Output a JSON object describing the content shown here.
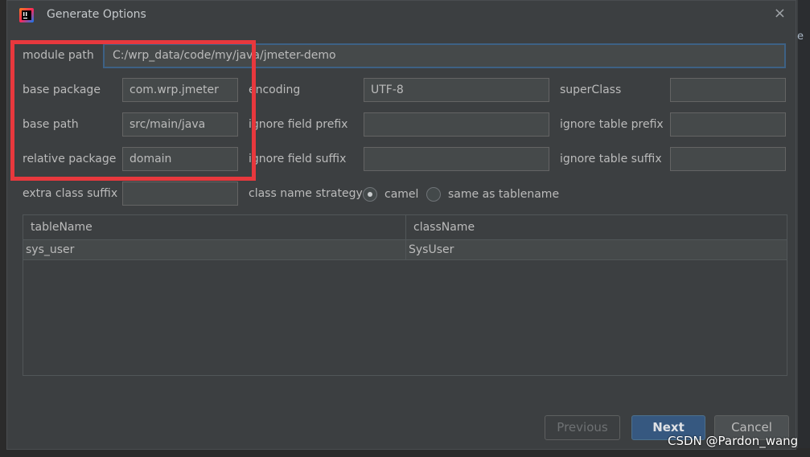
{
  "dialog": {
    "title": "Generate Options",
    "close_glyph": "×",
    "app_icon": "intellij-idea-icon"
  },
  "background": {
    "letter": "e"
  },
  "form": {
    "module_path": {
      "label": "module path",
      "value": "C:/wrp_data/code/my/java/jmeter-demo"
    },
    "base_package": {
      "label": "base package",
      "value": "com.wrp.jmeter"
    },
    "base_path": {
      "label": "base path",
      "value": "src/main/java"
    },
    "relative_package": {
      "label": "relative package",
      "value": "domain"
    },
    "extra_class_suffix": {
      "label": "extra class suffix",
      "value": ""
    },
    "encoding": {
      "label": "encoding",
      "value": "UTF-8"
    },
    "ignore_field_prefix": {
      "label": "ignore field prefix",
      "value": ""
    },
    "ignore_field_suffix": {
      "label": "ignore field suffix",
      "value": ""
    },
    "super_class": {
      "label": "superClass",
      "value": ""
    },
    "ignore_table_prefix": {
      "label": "ignore table prefix",
      "value": ""
    },
    "ignore_table_suffix": {
      "label": "ignore table suffix",
      "value": ""
    },
    "class_name_strategy": {
      "label": "class name strategy",
      "options": [
        {
          "label": "camel",
          "selected": true
        },
        {
          "label": "same as tablename",
          "selected": false
        }
      ]
    }
  },
  "table": {
    "columns": [
      "tableName",
      "className"
    ],
    "rows": [
      [
        "sys_user",
        "SysUser"
      ]
    ]
  },
  "buttons": {
    "previous": "Previous",
    "next": "Next",
    "cancel": "Cancel"
  },
  "annotation": {
    "highlight_color": "#e8383d"
  },
  "watermark": "CSDN @Pardon_wang"
}
